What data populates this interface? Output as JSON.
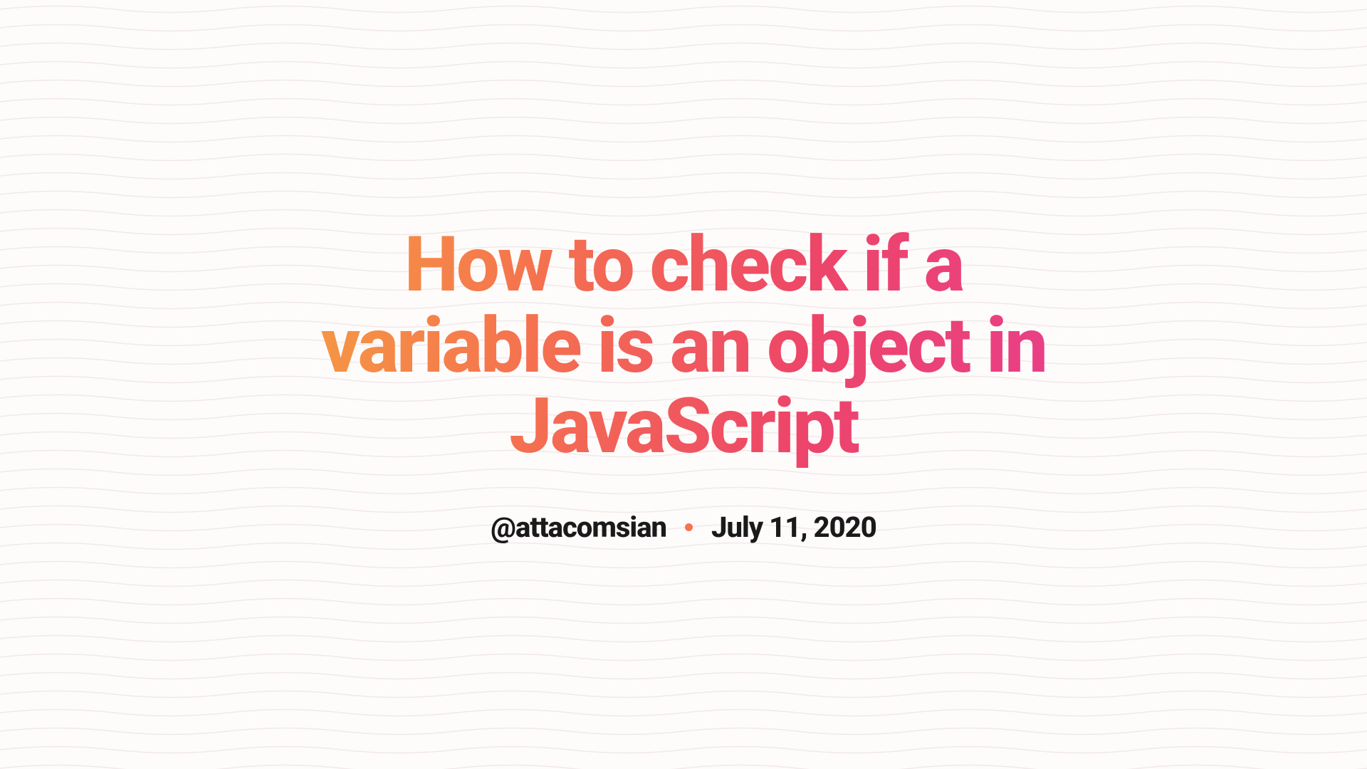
{
  "title": "How to check if a variable is an object in JavaScript",
  "author": "@attacomsian",
  "date": "July 11, 2020",
  "colors": {
    "gradient_start": "#f59e42",
    "gradient_end": "#e83e8c",
    "separator": "#f5734e",
    "text": "#1a1a1a",
    "background": "#fefbfb"
  }
}
